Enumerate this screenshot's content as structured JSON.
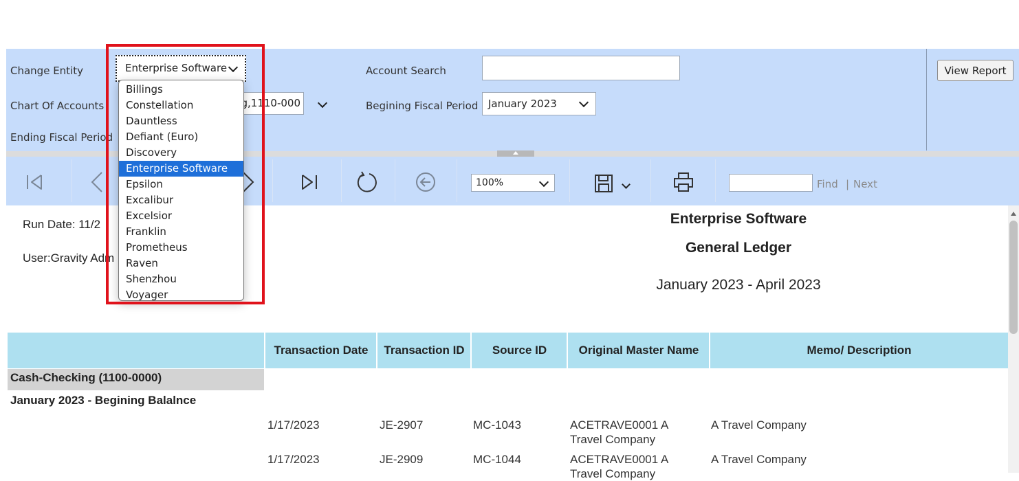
{
  "params": {
    "change_entity_label": "Change Entity",
    "entity_selected": "Enterprise Software",
    "chart_of_accounts_label": "Chart Of Accounts",
    "chart_of_accounts_value": "ng,1110-000",
    "ending_period_label": "Ending Fiscal Period",
    "account_search_label": "Account Search",
    "account_search_value": "",
    "beginning_period_label": "Begining Fiscal Period",
    "beginning_period_value": "January 2023",
    "view_report_label": "View Report"
  },
  "entity_options": [
    "Billings",
    "Constellation",
    "Dauntless",
    "Defiant (Euro)",
    "Discovery",
    "Enterprise Software",
    "Epsilon",
    "Excalibur",
    "Excelsior",
    "Franklin",
    "Prometheus",
    "Raven",
    "Shenzhou",
    "Voyager"
  ],
  "entity_selected_index": 5,
  "toolbar": {
    "zoom_value": "100%",
    "find_value": "",
    "find_label": "Find",
    "next_separator": "|",
    "next_label": "Next"
  },
  "report": {
    "run_date": "Run Date: 11/2",
    "user": "User:Gravity Adm",
    "company": "Enterprise Software",
    "title": "General Ledger",
    "period": "January 2023 - April 2023",
    "columns": [
      "Transaction Date",
      "Transaction ID",
      "Source ID",
      "Original Master Name",
      "Memo/ Description"
    ],
    "account_header": "Cash-Checking (1100-0000)",
    "beginning_balance_label": "January 2023 - Begining Balalnce",
    "rows": [
      {
        "date": "1/17/2023",
        "txn_id": "JE-2907",
        "source_id": "MC-1043",
        "master_name": "ACETRAVE0001 A Travel Company",
        "memo": "A Travel Company"
      },
      {
        "date": "1/17/2023",
        "txn_id": "JE-2909",
        "source_id": "MC-1044",
        "master_name": "ACETRAVE0001 A Travel Company",
        "memo": "A Travel Company"
      }
    ]
  },
  "colors": {
    "panel_bg": "#c6dcfb",
    "table_header_bg": "#aee0f0",
    "selection_blue": "#1e6fd9",
    "highlight_red": "#e0121b"
  }
}
